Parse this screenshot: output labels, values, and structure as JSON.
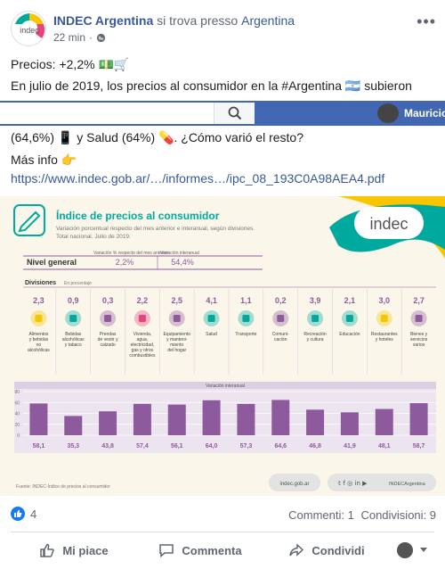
{
  "post": {
    "page_name": "INDEC Argentina",
    "location_prefix": "si trova presso",
    "location": "Argentina",
    "time": "22 min",
    "logo_text": "indec",
    "lines": [
      "Precios: +2,2% 💵🛒",
      "En julio de 2019, los precios al consumidor en la #Argentina 🇦🇷 subieron",
      "(64,6%) 📱 y Salud (64%) 💊. ¿Cómo varió el resto?",
      "Más info 👉"
    ],
    "url": "https://www.indec.gob.ar/…/informes…/ipc_08_193C0A98AEA4.pdf"
  },
  "topbar": {
    "search_placeholder": "",
    "profile_name": "Mauricio"
  },
  "infographic": {
    "title": "Índice de precios al consumidor",
    "subtitle1": "Variación porcentual respecto del mes anterior e interanual, según divisiones.",
    "subtitle2": "Total nacional. Julio de 2019.",
    "logo": "indec",
    "col_header_monthly": "Variación % respecto del mes anterior",
    "col_header_yearly": "Variación interanual",
    "nivel_general_label": "Nivel general",
    "nivel_general_monthly": "2,2%",
    "nivel_general_yearly": "54,4%",
    "divisiones_label": "Divisiones",
    "divisiones_sub": "En porcentaje",
    "interannual_label": "Variación interanual",
    "footer_source": "Fuente: INDEC-Índice de precios al consumidor",
    "footer_site": "indec.gob.ar",
    "footer_social": "INDECArgentina"
  },
  "chart_data": {
    "type": "bar",
    "categories": [
      "Alimentos y bebidas no alcohólicas",
      "Bebidas alcohólicas y tabaco",
      "Prendas de vestir y calzado",
      "Vivienda, agua, electricidad, gas y otros combustibles",
      "Equipamiento y mantenimiento del hogar",
      "Salud",
      "Transporte",
      "Comunicación",
      "Recreación y cultura",
      "Educación",
      "Restaurantes y hoteles",
      "Bienes y servicios varios"
    ],
    "category_lines": [
      [
        "Alimentos",
        "y bebidas",
        "no",
        "alcohólicas"
      ],
      [
        "Bebidas",
        "alcohólicas",
        "y tabaco"
      ],
      [
        "Prendas",
        "de vestir y",
        "calzado"
      ],
      [
        "Vivienda,",
        "agua,",
        "electricidad,",
        "gas y otros",
        "combustibles"
      ],
      [
        "Equipamiento",
        "y manteni-",
        "miento",
        "del hogar"
      ],
      [
        "Salud"
      ],
      [
        "Transporte"
      ],
      [
        "Comuni-",
        "cación"
      ],
      [
        "Recreación",
        "y cultura"
      ],
      [
        "Educación"
      ],
      [
        "Restaurantes",
        "y hoteles"
      ],
      [
        "Bienes y",
        "servicios",
        "varios"
      ]
    ],
    "monthly_labels": [
      "2,3",
      "0,9",
      "0,3",
      "2,2",
      "2,5",
      "4,1",
      "1,1",
      "0,2",
      "3,9",
      "2,1",
      "3,0",
      "2,7"
    ],
    "values": [
      58.1,
      35.3,
      43.8,
      57.4,
      56.1,
      64.0,
      57.3,
      64.6,
      46.8,
      41.9,
      48.1,
      58.7
    ],
    "value_labels": [
      "58,1",
      "35,3",
      "43,8",
      "57,4",
      "56,1",
      "64,0",
      "57,3",
      "64,6",
      "46,8",
      "41,9",
      "48,1",
      "58,7"
    ],
    "y_ticks": [
      "80",
      "60",
      "40",
      "20",
      "0"
    ],
    "ylim": [
      0,
      80
    ],
    "bar_color": "#8e5a9e",
    "grid": true
  },
  "engagement": {
    "likes": "4",
    "comments": "Commenti: 1",
    "shares": "Condivisioni: 9"
  },
  "actions": {
    "like": "Mi piace",
    "comment": "Commenta",
    "share": "Condividi"
  },
  "colors": {
    "link": "#385898",
    "topbar": "#4267b2",
    "accent_green": "#00a99d",
    "accent_purple": "#8e5a9e"
  }
}
